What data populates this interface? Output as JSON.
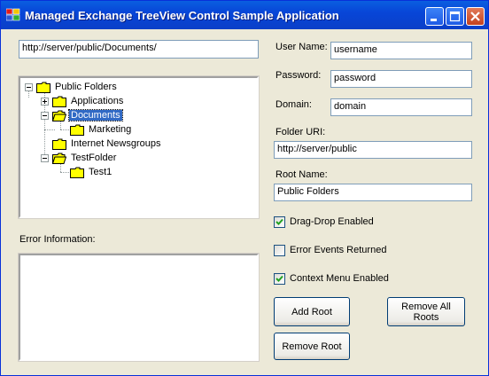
{
  "window": {
    "title": "Managed Exchange TreeView Control Sample Application"
  },
  "address": {
    "value": "http://server/public/Documents/"
  },
  "tree": {
    "nodes": [
      {
        "label": "Public Folders",
        "expander": "-"
      },
      {
        "label": "Applications",
        "expander": "+"
      },
      {
        "label": "Documents",
        "expander": "-",
        "selected": true
      },
      {
        "label": "Marketing"
      },
      {
        "label": "Internet Newsgroups"
      },
      {
        "label": "TestFolder",
        "expander": "-"
      },
      {
        "label": "Test1"
      }
    ]
  },
  "error": {
    "label": "Error Information:",
    "value": ""
  },
  "form": {
    "username_label": "User Name:",
    "username_value": "username",
    "password_label": "Password:",
    "password_value": "password",
    "domain_label": "Domain:",
    "domain_value": "domain",
    "folder_uri_label": "Folder URI:",
    "folder_uri_value": "http://server/public",
    "root_name_label": "Root Name:",
    "root_name_value": "Public Folders"
  },
  "options": {
    "drag_drop_label": "Drag-Drop Enabled",
    "drag_drop_checked": true,
    "error_events_label": "Error Events Returned",
    "error_events_checked": false,
    "context_menu_label": "Context Menu Enabled",
    "context_menu_checked": true
  },
  "buttons": {
    "add_root": "Add Root",
    "remove_all_roots_line1": "Remove All",
    "remove_all_roots_line2": "Roots",
    "remove_root": "Remove Root"
  },
  "colors": {
    "titlebar": "#0846d8",
    "selection": "#316ac5",
    "folder": "#ffff00"
  }
}
